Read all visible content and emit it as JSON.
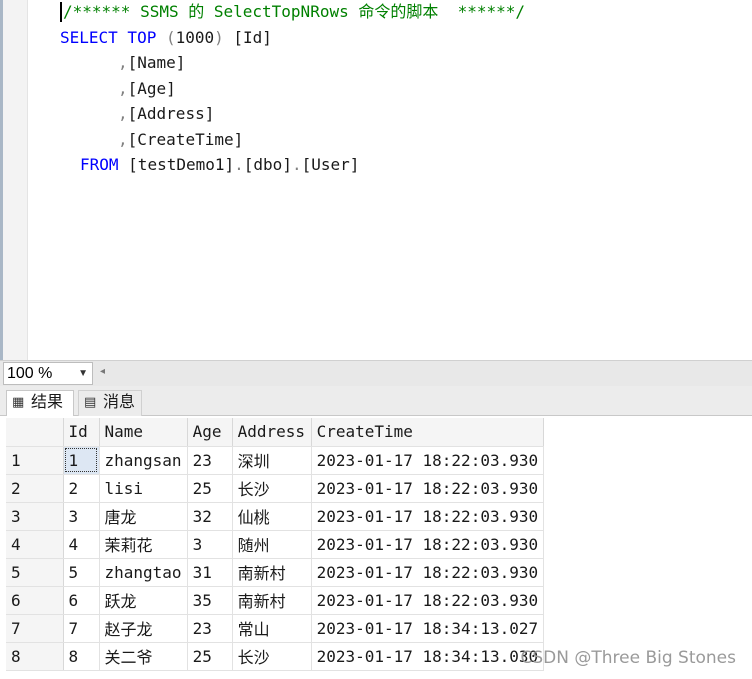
{
  "editor": {
    "lines": [
      {
        "parts": [
          {
            "t": "/****** SSMS 的 SelectTopNRows 命令的脚本  ******/",
            "c": "cm"
          }
        ]
      },
      {
        "parts": [
          {
            "t": "SELECT TOP ",
            "c": "kw"
          },
          {
            "t": "(",
            "c": "gr"
          },
          {
            "t": "1000",
            "c": "tk"
          },
          {
            "t": ") ",
            "c": "gr"
          },
          {
            "t": "[Id]",
            "c": "tk"
          }
        ]
      },
      {
        "parts": [
          {
            "t": ",",
            "c": "gr"
          },
          {
            "t": "[Name]",
            "c": "tk"
          }
        ]
      },
      {
        "parts": [
          {
            "t": ",",
            "c": "gr"
          },
          {
            "t": "[Age]",
            "c": "tk"
          }
        ]
      },
      {
        "parts": [
          {
            "t": ",",
            "c": "gr"
          },
          {
            "t": "[Address]",
            "c": "tk"
          }
        ]
      },
      {
        "parts": [
          {
            "t": ",",
            "c": "gr"
          },
          {
            "t": "[CreateTime]",
            "c": "tk"
          }
        ]
      },
      {
        "parts": [
          {
            "t": "FROM ",
            "c": "kw"
          },
          {
            "t": "[testDemo1]",
            "c": "tk"
          },
          {
            "t": ".",
            "c": "gr"
          },
          {
            "t": "[dbo]",
            "c": "tk"
          },
          {
            "t": ".",
            "c": "gr"
          },
          {
            "t": "[User]",
            "c": "tk"
          }
        ]
      }
    ]
  },
  "zoom": {
    "value": "100 %"
  },
  "tabs": {
    "results": "结果",
    "messages": "消息"
  },
  "grid": {
    "columns": [
      "Id",
      "Name",
      "Age",
      "Address",
      "CreateTime"
    ],
    "rows": [
      {
        "rn": "1",
        "cells": [
          "1",
          "zhangsan",
          "23",
          "深圳",
          "2023-01-17 18:22:03.930"
        ]
      },
      {
        "rn": "2",
        "cells": [
          "2",
          "lisi",
          "25",
          "长沙",
          "2023-01-17 18:22:03.930"
        ]
      },
      {
        "rn": "3",
        "cells": [
          "3",
          "唐龙",
          "32",
          "仙桃",
          "2023-01-17 18:22:03.930"
        ]
      },
      {
        "rn": "4",
        "cells": [
          "4",
          "茉莉花",
          "3",
          "随州",
          "2023-01-17 18:22:03.930"
        ]
      },
      {
        "rn": "5",
        "cells": [
          "5",
          "zhangtao",
          "31",
          "南新村",
          "2023-01-17 18:22:03.930"
        ]
      },
      {
        "rn": "6",
        "cells": [
          "6",
          "跃龙",
          "35",
          "南新村",
          "2023-01-17 18:22:03.930"
        ]
      },
      {
        "rn": "7",
        "cells": [
          "7",
          "赵子龙",
          "23",
          "常山",
          "2023-01-17 18:34:13.027"
        ]
      },
      {
        "rn": "8",
        "cells": [
          "8",
          "关二爷",
          "25",
          "长沙",
          "2023-01-17 18:34:13.030"
        ]
      }
    ]
  },
  "watermark": "CSDN @Three Big Stones",
  "colors": {
    "keyword": "#0000ff",
    "comment": "#008000",
    "punct": "#808080"
  }
}
